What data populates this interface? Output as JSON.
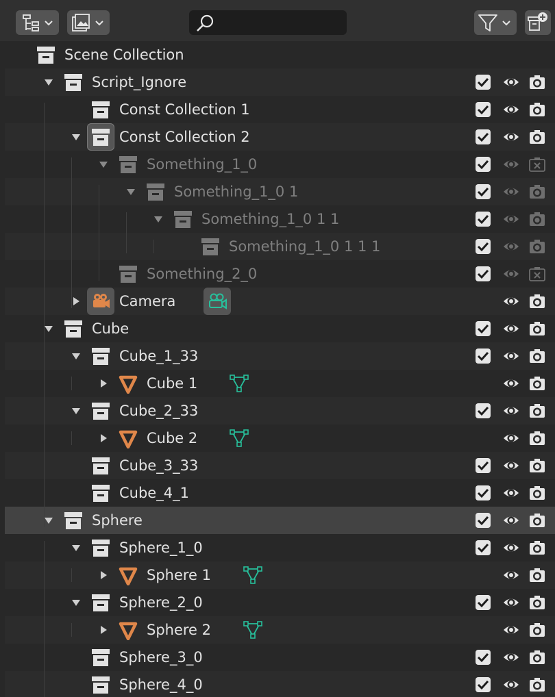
{
  "header": {
    "display_mode_icon": "outliner-display-mode-icon",
    "filter_type_icon": "image-library-icon",
    "search": {
      "value": "",
      "placeholder": ""
    },
    "filter_icon": "funnel-filter-icon",
    "new_collection_icon": "new-collection-icon"
  },
  "colors": {
    "background": "#282828",
    "row_alt": "#2c2c2c",
    "selected_row": "#434343",
    "text": "#e2e2e2",
    "text_dim": "#8a8a8a",
    "object_orange": "#e0874a",
    "data_teal": "#27c09c"
  },
  "rows": [
    {
      "label": "Scene Collection",
      "depth": 0,
      "expand": "none",
      "icon": "collection-icon",
      "checkbox": false,
      "eye": false,
      "camera": false,
      "dim": false
    },
    {
      "label": "Script_Ignore",
      "depth": 1,
      "expand": "open",
      "icon": "collection-icon",
      "checkbox": true,
      "eye": true,
      "camera": true,
      "dim": false
    },
    {
      "label": "Const Collection 1",
      "depth": 2,
      "expand": "none",
      "icon": "collection-icon",
      "checkbox": true,
      "eye": true,
      "camera": true,
      "dim": false
    },
    {
      "label": "Const Collection 2",
      "depth": 2,
      "expand": "open",
      "icon": "collection-icon-active",
      "checkbox": true,
      "eye": true,
      "camera": true,
      "dim": false
    },
    {
      "label": "Something_1_0",
      "depth": 3,
      "expand": "open",
      "icon": "collection-icon",
      "checkbox": true,
      "eye": true,
      "camera": true,
      "camera_disabled": true,
      "dim": true
    },
    {
      "label": "Something_1_0 1",
      "depth": 4,
      "expand": "open",
      "icon": "collection-icon",
      "checkbox": true,
      "eye": true,
      "camera": true,
      "dim": true
    },
    {
      "label": "Something_1_0 1 1",
      "depth": 5,
      "expand": "open",
      "icon": "collection-icon",
      "checkbox": true,
      "eye": true,
      "camera": true,
      "dim": true
    },
    {
      "label": "Something_1_0 1 1 1",
      "depth": 6,
      "expand": "none",
      "icon": "collection-icon",
      "checkbox": true,
      "eye": true,
      "camera": true,
      "dim": true
    },
    {
      "label": "Something_2_0",
      "depth": 3,
      "expand": "none",
      "icon": "collection-icon",
      "checkbox": true,
      "eye": true,
      "camera": true,
      "camera_disabled": true,
      "dim": true
    },
    {
      "label": "Camera",
      "depth": 2,
      "expand": "closed",
      "icon": "camera-object-icon",
      "extra": "camera-data-icon",
      "checkbox": false,
      "eye": true,
      "camera": true,
      "dim": false
    },
    {
      "label": "Cube",
      "depth": 1,
      "expand": "open",
      "icon": "collection-icon",
      "checkbox": true,
      "eye": true,
      "camera": true,
      "dim": false
    },
    {
      "label": "Cube_1_33",
      "depth": 2,
      "expand": "open",
      "icon": "collection-icon",
      "checkbox": true,
      "eye": true,
      "camera": true,
      "dim": false
    },
    {
      "label": "Cube 1",
      "depth": 3,
      "expand": "closed",
      "icon": "mesh-object-icon",
      "extra": "mesh-data-icon",
      "checkbox": false,
      "eye": true,
      "camera": true,
      "dim": false
    },
    {
      "label": "Cube_2_33",
      "depth": 2,
      "expand": "open",
      "icon": "collection-icon",
      "checkbox": true,
      "eye": true,
      "camera": true,
      "dim": false
    },
    {
      "label": "Cube 2",
      "depth": 3,
      "expand": "closed",
      "icon": "mesh-object-icon",
      "extra": "mesh-data-icon",
      "checkbox": false,
      "eye": true,
      "camera": true,
      "dim": false
    },
    {
      "label": "Cube_3_33",
      "depth": 2,
      "expand": "none",
      "icon": "collection-icon",
      "checkbox": true,
      "eye": true,
      "camera": true,
      "dim": false
    },
    {
      "label": "Cube_4_1",
      "depth": 2,
      "expand": "none",
      "icon": "collection-icon",
      "checkbox": true,
      "eye": true,
      "camera": true,
      "dim": false
    },
    {
      "label": "Sphere",
      "depth": 1,
      "expand": "open",
      "icon": "collection-icon",
      "checkbox": true,
      "eye": true,
      "camera": true,
      "dim": false,
      "selected": true
    },
    {
      "label": "Sphere_1_0",
      "depth": 2,
      "expand": "open",
      "icon": "collection-icon",
      "checkbox": true,
      "eye": true,
      "camera": true,
      "dim": false
    },
    {
      "label": "Sphere 1",
      "depth": 3,
      "expand": "closed",
      "icon": "mesh-object-icon",
      "extra": "mesh-data-icon",
      "checkbox": false,
      "eye": true,
      "camera": true,
      "dim": false
    },
    {
      "label": "Sphere_2_0",
      "depth": 2,
      "expand": "open",
      "icon": "collection-icon",
      "checkbox": true,
      "eye": true,
      "camera": true,
      "dim": false
    },
    {
      "label": "Sphere 2",
      "depth": 3,
      "expand": "closed",
      "icon": "mesh-object-icon",
      "extra": "mesh-data-icon",
      "checkbox": false,
      "eye": true,
      "camera": true,
      "dim": false
    },
    {
      "label": "Sphere_3_0",
      "depth": 2,
      "expand": "none",
      "icon": "collection-icon",
      "checkbox": true,
      "eye": true,
      "camera": true,
      "dim": false
    },
    {
      "label": "Sphere_4_0",
      "depth": 2,
      "expand": "none",
      "icon": "collection-icon",
      "checkbox": true,
      "eye": true,
      "camera": true,
      "dim": false
    }
  ]
}
